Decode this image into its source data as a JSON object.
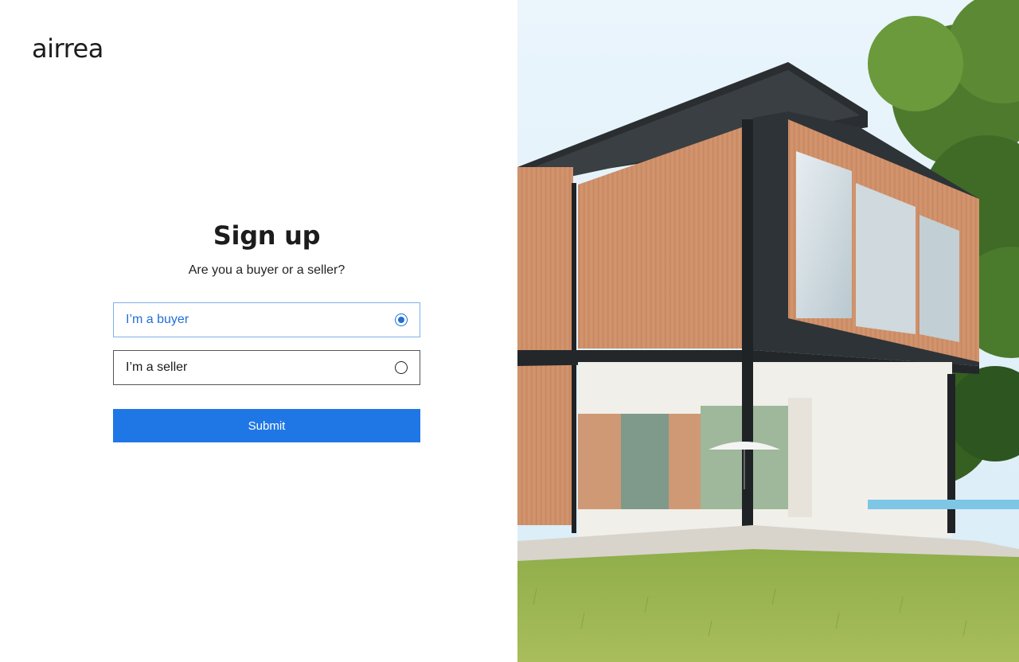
{
  "brand": {
    "logo_text": "airrea"
  },
  "signup": {
    "title": "Sign up",
    "subtitle": "Are you a buyer or a seller?",
    "options": [
      {
        "label": "I’m a buyer",
        "selected": true
      },
      {
        "label": "I’m a seller",
        "selected": false
      }
    ],
    "submit_label": "Submit"
  },
  "colors": {
    "accent": "#1f77e6",
    "selected_text": "#1f6fd8",
    "selected_border": "#7fb0ea"
  },
  "hero_image": {
    "subject": "modern two-story house with wood cladding and glass walls in a green garden"
  }
}
